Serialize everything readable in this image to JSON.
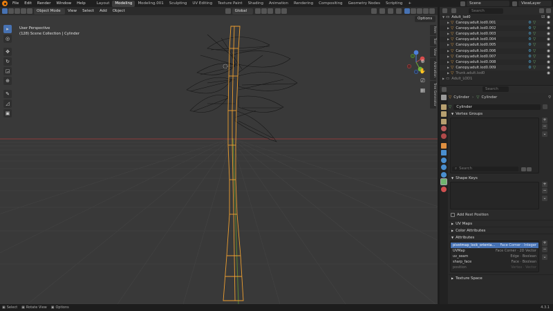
{
  "topbar": {
    "menus": [
      "File",
      "Edit",
      "Render",
      "Window",
      "Help"
    ],
    "workspaces": [
      "Layout",
      "Modeling",
      "Modeling.001",
      "Sculpting",
      "UV Editing",
      "Texture Paint",
      "Shading",
      "Animation",
      "Rendering",
      "Compositing",
      "Geometry Nodes",
      "Scripting"
    ],
    "active_workspace": "Modeling",
    "add_tab": "+",
    "scene": "Scene",
    "view_layer": "ViewLayer"
  },
  "viewport": {
    "mode": "Object Mode",
    "menus": [
      "View",
      "Select",
      "Add",
      "Object"
    ],
    "transform_orientation": "Global",
    "options": "Options",
    "info_line1": "User Perspective",
    "info_line2": "(128) Scene Collection | Cylinder",
    "side_tabs": [
      "Item",
      "Tool",
      "View",
      "Animation",
      "Tree Generator"
    ]
  },
  "outliner": {
    "search_placeholder": "Search",
    "collection": "Adult_lod0",
    "items": [
      "Canopy.adult.lod0.001",
      "Canopy.adult.lod0.002",
      "Canopy.adult.lod0.003",
      "Canopy.adult.lod0.004",
      "Canopy.adult.lod0.005",
      "Canopy.adult.lod0.006",
      "Canopy.adult.lod0.007",
      "Canopy.adult.lod0.008",
      "Canopy.adult.lod0.009",
      "Trunk.adult.lod0"
    ],
    "next_collection": "Adult_LOD1"
  },
  "properties": {
    "search_placeholder": "Search",
    "breadcrumb_object": "Cylinder",
    "breadcrumb_data": "Cylinder",
    "data_name": "Cylinder",
    "vertex_groups": "Vertex Groups",
    "vg_search_placeholder": "Search",
    "shape_keys": "Shape Keys",
    "add_rest_position": "Add Rest Position",
    "uv_maps": "UV Maps",
    "color_attributes": "Color Attributes",
    "attributes": "Attributes",
    "attribute_rows": [
      {
        "name": "pivotmap_lock_orienta...",
        "domain": "Face Corner",
        "type": "Integer"
      },
      {
        "name": "UVMap",
        "domain": "Face Corner",
        "type": "2D Vector"
      },
      {
        "name": "uv_seam",
        "domain": "Edge",
        "type": "Boolean"
      },
      {
        "name": "sharp_face",
        "domain": "Face",
        "type": "Boolean"
      },
      {
        "name": "position",
        "domain": "Vertex",
        "type": "Vector"
      }
    ],
    "texture_space": "Texture Space"
  },
  "statusbar": {
    "select": "Select",
    "rotate_view": "Rotate View",
    "options": "Options",
    "version": "4.3.1"
  },
  "colors": {
    "accent": "#4772b3",
    "selection_orange": "#f0a030",
    "grid": "#444444",
    "axis_red": "#8f3a3a",
    "axis_green": "#5c8a2f"
  }
}
